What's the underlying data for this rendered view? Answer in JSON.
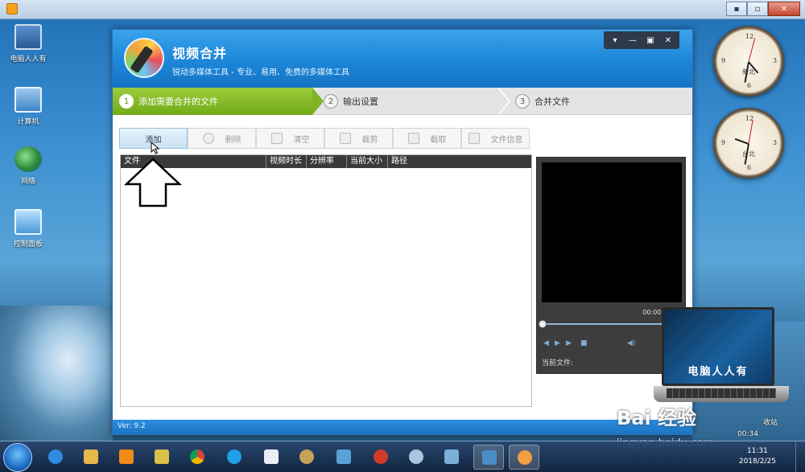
{
  "outer_window": {
    "controls": [
      "▪",
      "▫",
      "✕"
    ]
  },
  "desktop_icons": [
    {
      "label": "电脑人人有"
    },
    {
      "label": "计算机"
    },
    {
      "label": "网络"
    },
    {
      "label": "控制面板"
    }
  ],
  "clocks": [
    {
      "city": "新北"
    },
    {
      "city": "台北"
    }
  ],
  "app": {
    "title": "视频合并",
    "subtitle": "锐动多媒体工具 - 专业、易用、免费的多媒体工具",
    "window_controls": [
      "▾",
      "—",
      "▣",
      "✕"
    ],
    "steps": [
      {
        "num": "1",
        "label": "添加需要合并的文件",
        "active": true
      },
      {
        "num": "2",
        "label": "输出设置",
        "active": false
      },
      {
        "num": "3",
        "label": "合并文件",
        "active": false
      }
    ],
    "toolbar": {
      "add": "添加",
      "delete": "删除",
      "clear": "清空",
      "cut": "裁剪",
      "crop": "截取",
      "file_info": "文件信息"
    },
    "table_headers": [
      "文件",
      "视频时长",
      "分辨率",
      "当前大小",
      "路径"
    ],
    "preview": {
      "time": "00:00:00 / 0",
      "current_file_label": "当前文件:"
    },
    "version": "Ver: 9.2"
  },
  "watermark": {
    "laptop_text": "电脑人人有",
    "brand": "Bai 经验",
    "url": "jingyan.baidu.com",
    "tag": "收站",
    "time": "00:34"
  },
  "taskbar": {
    "time": "11:31",
    "date": "2018/2/25"
  }
}
